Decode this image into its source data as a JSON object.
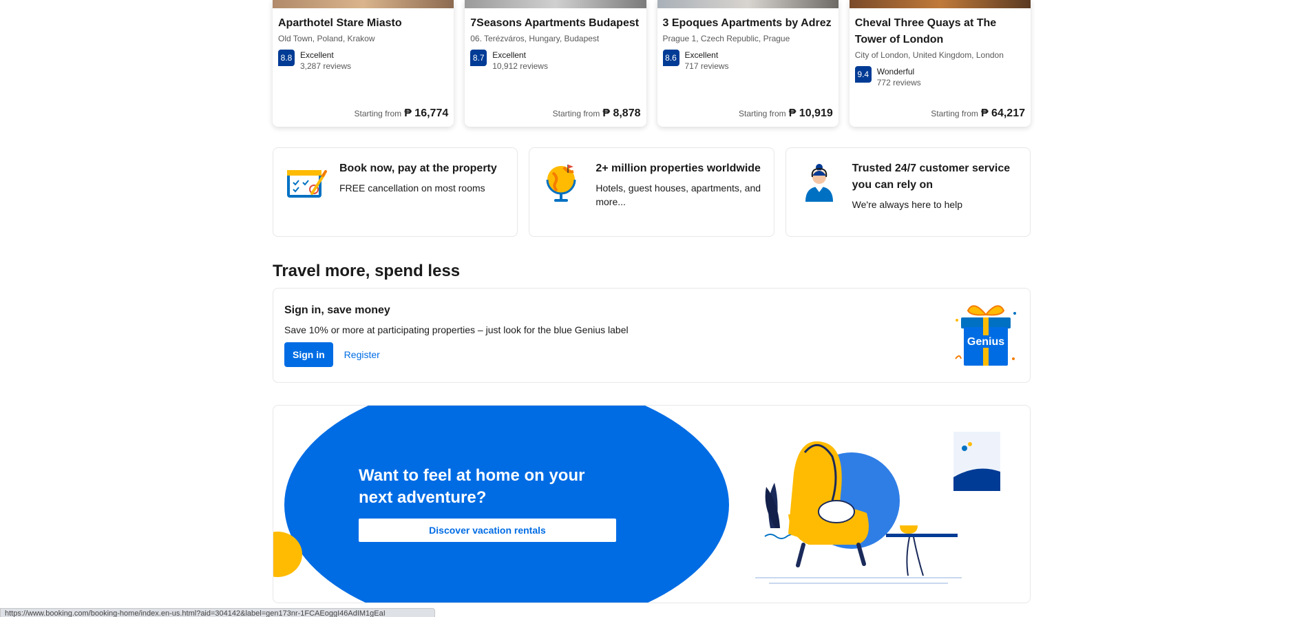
{
  "properties": [
    {
      "name": "Aparthotel Stare Miasto",
      "location": "Old Town, Poland, Krakow",
      "score": "8.8",
      "rating": "Excellent",
      "reviews": "3,287 reviews",
      "price_label": "Starting from",
      "price": "₱ 16,774"
    },
    {
      "name": "7Seasons Apartments Budapest",
      "location": "06. Terézváros, Hungary, Budapest",
      "score": "8.7",
      "rating": "Excellent",
      "reviews": "10,912 reviews",
      "price_label": "Starting from",
      "price": "₱ 8,878"
    },
    {
      "name": "3 Epoques Apartments by Adrez",
      "location": "Prague 1, Czech Republic, Prague",
      "score": "8.6",
      "rating": "Excellent",
      "reviews": "717 reviews",
      "price_label": "Starting from",
      "price": "₱ 10,919"
    },
    {
      "name": "Cheval Three Quays at The Tower of London",
      "location": "City of London, United Kingdom, London",
      "score": "9.4",
      "rating": "Wonderful",
      "reviews": "772 reviews",
      "price_label": "Starting from",
      "price": "₱ 64,217"
    }
  ],
  "features": [
    {
      "title": "Book now, pay at the property",
      "desc": "FREE cancellation on most rooms",
      "icon": "calendar-icon"
    },
    {
      "title": "2+ million properties worldwide",
      "desc": "Hotels, guest houses, apartments, and more...",
      "icon": "globe-icon"
    },
    {
      "title": "Trusted 24/7 customer service you can rely on",
      "desc": "We're always here to help",
      "icon": "support-agent-icon"
    }
  ],
  "section_title": "Travel more, spend less",
  "genius": {
    "title": "Sign in, save money",
    "desc": "Save 10% or more at participating properties – just look for the blue Genius label",
    "signin_label": "Sign in",
    "register_label": "Register",
    "gift_label": "Genius"
  },
  "vacation": {
    "title": "Want to feel at home on your next adventure?",
    "button_label": "Discover vacation rentals"
  },
  "status_url": "https://www.booking.com/booking-home/index.en-us.html?aid=304142&label=gen173nr-1FCAEoggI46AdIM1gEaI",
  "colors": {
    "brand_blue": "#006ce4",
    "score_blue": "#003b95",
    "accent_yellow": "#febb02"
  }
}
